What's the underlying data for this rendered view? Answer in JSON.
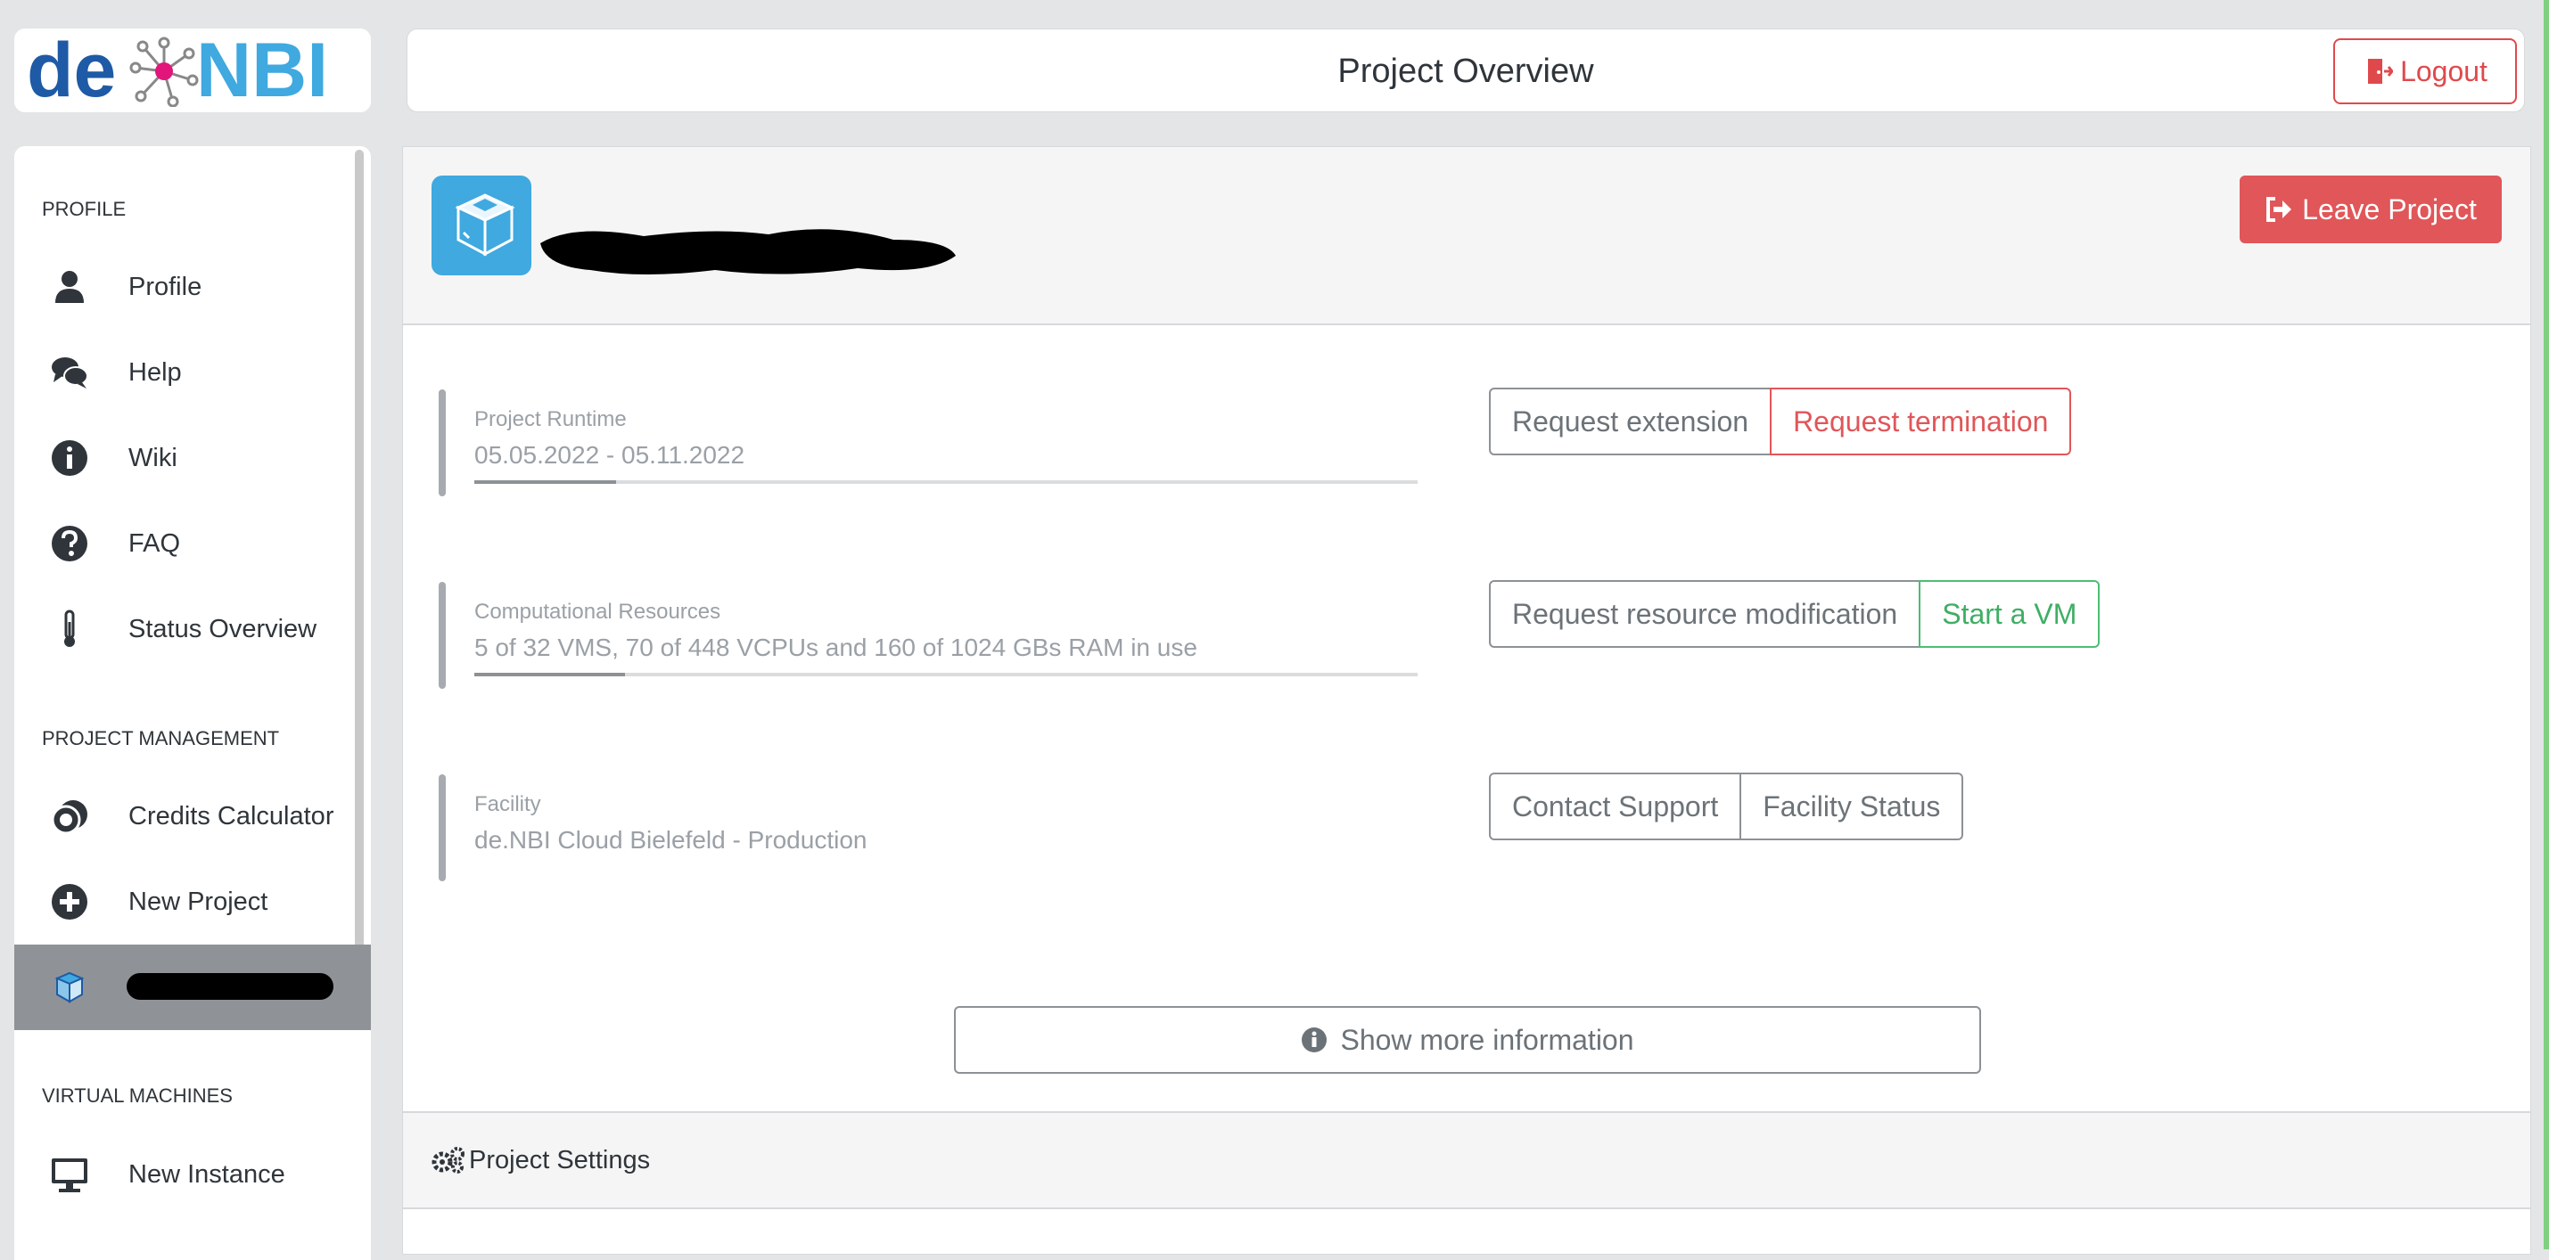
{
  "brand": {
    "logo_left": "de",
    "logo_right": "NBI"
  },
  "header": {
    "title": "Project Overview",
    "logout_label": "Logout"
  },
  "sidebar": {
    "sections": [
      {
        "title": "PROFILE"
      },
      {
        "title": "PROJECT MANAGEMENT"
      },
      {
        "title": "VIRTUAL MACHINES"
      }
    ],
    "items": [
      {
        "label": "Profile",
        "icon": "user-icon"
      },
      {
        "label": "Help",
        "icon": "comments-icon"
      },
      {
        "label": "Wiki",
        "icon": "info-circle-icon"
      },
      {
        "label": "FAQ",
        "icon": "question-circle-icon"
      },
      {
        "label": "Status Overview",
        "icon": "thermometer-icon"
      },
      {
        "label": "Credits Calculator",
        "icon": "coins-icon"
      },
      {
        "label": "New Project",
        "icon": "plus-circle-icon"
      },
      {
        "label": "",
        "icon": "cube-icon"
      },
      {
        "label": "New Instance",
        "icon": "monitor-icon"
      }
    ]
  },
  "project": {
    "leave_label": "Leave Project",
    "runtime": {
      "label": "Project Runtime",
      "value": "05.05.2022 - 05.11.2022",
      "progress_percent": 15
    },
    "resources": {
      "label": "Computational Resources",
      "value": "5 of 32 VMS, 70 of 448 VCPUs and 160 of 1024 GBs RAM in use",
      "progress_percent": 16
    },
    "facility": {
      "label": "Facility",
      "value": "de.NBI Cloud Bielefeld - Production"
    },
    "buttons": {
      "request_extension": "Request extension",
      "request_termination": "Request termination",
      "request_resource_modification": "Request resource modification",
      "start_vm": "Start a VM",
      "contact_support": "Contact Support",
      "facility_status": "Facility Status"
    },
    "show_more_label": "Show more information"
  },
  "settings": {
    "title": "Project Settings"
  },
  "colors": {
    "primary": "#3fa9e0",
    "danger": "#e05659",
    "success": "#4dbd74",
    "brand_dark": "#1e5aa5"
  }
}
